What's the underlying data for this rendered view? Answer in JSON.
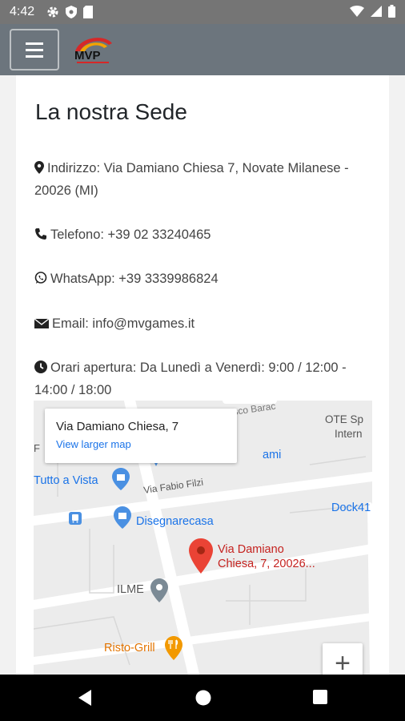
{
  "status_bar": {
    "time": "4:42",
    "left_icons": [
      "gear-icon",
      "shield-icon",
      "sd-card-icon"
    ],
    "right_icons": [
      "wifi-icon",
      "cellular-icon",
      "battery-icon"
    ]
  },
  "header": {
    "menu_icon": "hamburger-icon",
    "logo_text": "MVP"
  },
  "page": {
    "title": "La nostra Sede",
    "address": "Indirizzo: Via Damiano Chiesa 7, Novate Milanese - 20026 (MI)",
    "phone": "Telefono: +39 02 33240465",
    "whatsapp": "WhatsApp: +39 3339986824",
    "email": "Email: info@mvgames.it",
    "hours": "Orari apertura: Da Lunedì a Venerdì: 9:00 / 12:00 - 14:00 / 18:00"
  },
  "map": {
    "popup_title": "Via Damiano Chiesa, 7",
    "popup_link": "View larger map",
    "zoom_in": "+",
    "labels": {
      "road_baracca": "sco Barac",
      "ote": "OTE Sp",
      "ote2": "Intern",
      "tutto_a_vista": "Tutto a Vista",
      "games": "ami",
      "via_fabio_filzi": "Via Fabio Filzi",
      "dock": "Dock41",
      "disegnarecasa": "Disegnarecasa",
      "pin_line1": "Via Damiano",
      "pin_line2": "Chiesa, 7, 20026...",
      "ilme": "ILME",
      "risto_grill": "Risto-Grill",
      "left_edge": "F"
    }
  },
  "colors": {
    "status_bar": "#757575",
    "header": "#6c757d",
    "link": "#1a73e8",
    "poi_blue": "#4a90e2",
    "pin_red": "#ea4335",
    "poi_orange": "#f29900"
  }
}
